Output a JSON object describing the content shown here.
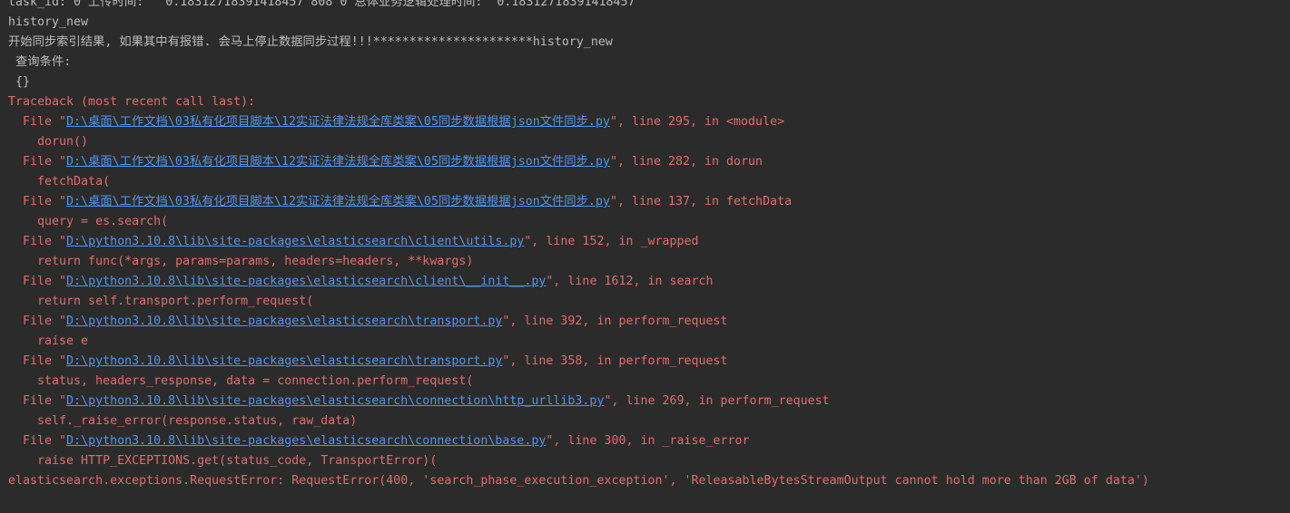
{
  "console": {
    "lines": [
      {
        "kind": "normal",
        "text": "task_id: 0 上传时间:   0.18312718391418457 808 0 总体业务逻辑处理时间:  0.18312718391418457"
      },
      {
        "kind": "normal",
        "text": "history_new"
      },
      {
        "kind": "normal",
        "text": "开始同步索引结果, 如果其中有报错. 会马上停止数据同步过程!!!**********************history_new"
      },
      {
        "kind": "normal",
        "text": " 查询条件:"
      },
      {
        "kind": "normal",
        "text": " {}"
      },
      {
        "kind": "err",
        "text": "Traceback (most recent call last):"
      },
      {
        "kind": "file",
        "prefix": "  File \"",
        "path": "D:\\桌面\\工作文档\\03私有化项目脚本\\12实证法律法规全库类案\\05同步数据根据json文件同步.py",
        "suffix": "\", line 295, in <module>"
      },
      {
        "kind": "err",
        "text": "    dorun()"
      },
      {
        "kind": "file",
        "prefix": "  File \"",
        "path": "D:\\桌面\\工作文档\\03私有化项目脚本\\12实证法律法规全库类案\\05同步数据根据json文件同步.py",
        "suffix": "\", line 282, in dorun"
      },
      {
        "kind": "err",
        "text": "    fetchData("
      },
      {
        "kind": "file",
        "prefix": "  File \"",
        "path": "D:\\桌面\\工作文档\\03私有化项目脚本\\12实证法律法规全库类案\\05同步数据根据json文件同步.py",
        "suffix": "\", line 137, in fetchData"
      },
      {
        "kind": "err",
        "text": "    query = es.search("
      },
      {
        "kind": "file",
        "prefix": "  File \"",
        "path": "D:\\python3.10.8\\lib\\site-packages\\elasticsearch\\client\\utils.py",
        "suffix": "\", line 152, in _wrapped"
      },
      {
        "kind": "err",
        "text": "    return func(*args, params=params, headers=headers, **kwargs)"
      },
      {
        "kind": "file",
        "prefix": "  File \"",
        "path": "D:\\python3.10.8\\lib\\site-packages\\elasticsearch\\client\\__init__.py",
        "suffix": "\", line 1612, in search"
      },
      {
        "kind": "err",
        "text": "    return self.transport.perform_request("
      },
      {
        "kind": "file",
        "prefix": "  File \"",
        "path": "D:\\python3.10.8\\lib\\site-packages\\elasticsearch\\transport.py",
        "suffix": "\", line 392, in perform_request"
      },
      {
        "kind": "err",
        "text": "    raise e"
      },
      {
        "kind": "file",
        "prefix": "  File \"",
        "path": "D:\\python3.10.8\\lib\\site-packages\\elasticsearch\\transport.py",
        "suffix": "\", line 358, in perform_request"
      },
      {
        "kind": "err",
        "text": "    status, headers_response, data = connection.perform_request("
      },
      {
        "kind": "file",
        "prefix": "  File \"",
        "path": "D:\\python3.10.8\\lib\\site-packages\\elasticsearch\\connection\\http_urllib3.py",
        "suffix": "\", line 269, in perform_request"
      },
      {
        "kind": "err",
        "text": "    self._raise_error(response.status, raw_data)"
      },
      {
        "kind": "file",
        "prefix": "  File \"",
        "path": "D:\\python3.10.8\\lib\\site-packages\\elasticsearch\\connection\\base.py",
        "suffix": "\", line 300, in _raise_error"
      },
      {
        "kind": "err",
        "text": "    raise HTTP_EXCEPTIONS.get(status_code, TransportError)("
      },
      {
        "kind": "err",
        "text": "elasticsearch.exceptions.RequestError: RequestError(400, 'search_phase_execution_exception', 'ReleasableBytesStreamOutput cannot hold more than 2GB of data')"
      }
    ]
  },
  "colors": {
    "background": "#2b2b2b",
    "normal_text": "#bbbbbb",
    "error_text": "#e26c6c",
    "link_text": "#5394ec"
  }
}
